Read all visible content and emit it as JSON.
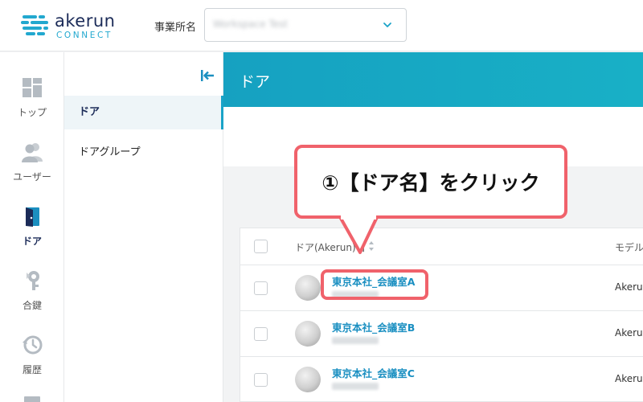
{
  "header": {
    "logo_word": "akerun",
    "logo_sub": "CONNECT",
    "office_label": "事業所名",
    "office_value": "Workspace Test"
  },
  "leftnav": {
    "items": [
      {
        "label": "トップ",
        "icon": "dashboard-icon"
      },
      {
        "label": "ユーザー",
        "icon": "users-icon"
      },
      {
        "label": "ドア",
        "icon": "door-icon",
        "active": true
      },
      {
        "label": "合鍵",
        "icon": "key-icon"
      },
      {
        "label": "履歴",
        "icon": "history-icon"
      }
    ]
  },
  "subnav": {
    "items": [
      {
        "label": "ドア",
        "active": true
      },
      {
        "label": "ドアグループ"
      }
    ]
  },
  "main": {
    "title": "ドア",
    "table": {
      "columns": [
        "ドア(Akerun)名",
        "モデル"
      ],
      "rows": [
        {
          "name": "東京本社_会議室A",
          "model": "Akerun"
        },
        {
          "name": "東京本社_会議室B",
          "model": "Akerun"
        },
        {
          "name": "東京本社_会議室C",
          "model": "Akerun"
        }
      ]
    }
  },
  "callout": {
    "text": "①【ドア名】をクリック"
  },
  "colors": {
    "accent": "#18a8c6",
    "link": "#1a8fc1",
    "callout_border": "#f0626b",
    "brand_navy": "#1b2b58"
  }
}
